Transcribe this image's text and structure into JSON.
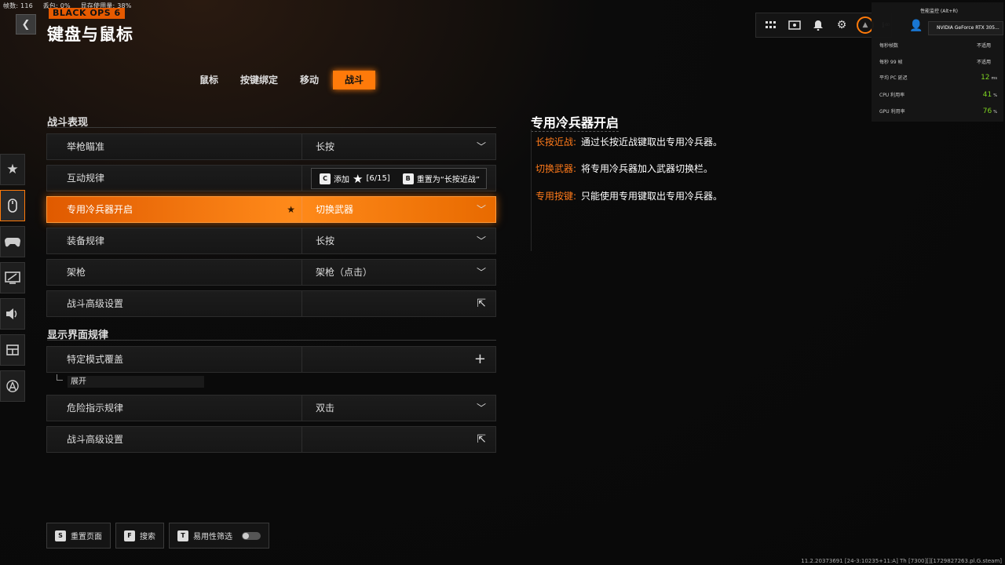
{
  "overlay": {
    "fps_label": "帧数: 116",
    "packet_label": "丢包: 0%",
    "vram_label": "显存使用量: 38%"
  },
  "header": {
    "logo": "BLACK OPS 6",
    "title": "键盘与鼠标",
    "back_icon": "chevron-left-icon"
  },
  "tabs": [
    {
      "label": "鼠标",
      "active": false
    },
    {
      "label": "按键绑定",
      "active": false
    },
    {
      "label": "移动",
      "active": false
    },
    {
      "label": "战斗",
      "active": true
    }
  ],
  "sidebar": [
    "star-icon",
    "mouse-icon",
    "gamepad-icon",
    "display-icon",
    "audio-icon",
    "interface-icon",
    "network-icon"
  ],
  "sections": {
    "combat": {
      "title": "战斗表现",
      "rows": [
        {
          "label": "举枪瞄准",
          "value": "长按"
        },
        {
          "label": "互动规律",
          "value": ""
        },
        {
          "label": "专用冷兵器开启",
          "value": "切换武器",
          "active": true
        },
        {
          "label": "装备规律",
          "value": "长按"
        },
        {
          "label": "架枪",
          "value": "架枪（点击）"
        },
        {
          "label": "战斗高级设置",
          "value": ""
        }
      ]
    },
    "hud": {
      "title": "显示界面规律",
      "rows": [
        {
          "label": "特定模式覆盖",
          "value": ""
        },
        {
          "label": "危险指示规律",
          "value": "双击"
        },
        {
          "label": "战斗高级设置",
          "value": ""
        }
      ],
      "expand_label": "展开"
    }
  },
  "tooltip": {
    "add_key": "C",
    "add_label": "添加",
    "count": "[6/15]",
    "reset_key": "B",
    "reset_label": "重置为“长按近战”"
  },
  "detail": {
    "title": "专用冷兵器开启",
    "lines": [
      {
        "term": "长按近战:",
        "desc": "通过长按近战键取出专用冷兵器。"
      },
      {
        "term": "切换武器:",
        "desc": "将专用冷兵器加入武器切换栏。"
      },
      {
        "term": "专用按键:",
        "desc": "只能使用专用键取出专用冷兵器。"
      }
    ]
  },
  "bottom_bar": [
    {
      "key": "S",
      "label": "重置页面"
    },
    {
      "key": "F",
      "label": "搜索"
    },
    {
      "key": "T",
      "label": "易用性筛选"
    }
  ],
  "top_icons": [
    "grid-icon",
    "profile-card-icon",
    "bell-icon",
    "gear-icon"
  ],
  "player_id": "ℹ︎  ͤ ͦ",
  "perf_overlay": {
    "header": "性能监控 (Alt+R)",
    "gpu": "NVIDIA GeForce RTX 305...",
    "rows": [
      {
        "label": "每秒帧数",
        "value": "不适用",
        "unit": ""
      },
      {
        "label": "每秒 99 帧",
        "value": "不适用",
        "unit": ""
      },
      {
        "label": "平均 PC 延迟",
        "value": "12",
        "unit": "ms"
      },
      {
        "label": "CPU 利用率",
        "value": "41",
        "unit": "%"
      },
      {
        "label": "GPU 利用率",
        "value": "76",
        "unit": "%"
      }
    ]
  },
  "build_info": "11.2.20373691 [24-3:10235+11:A] Th [7300][][1729827263.pl.G.steam]"
}
